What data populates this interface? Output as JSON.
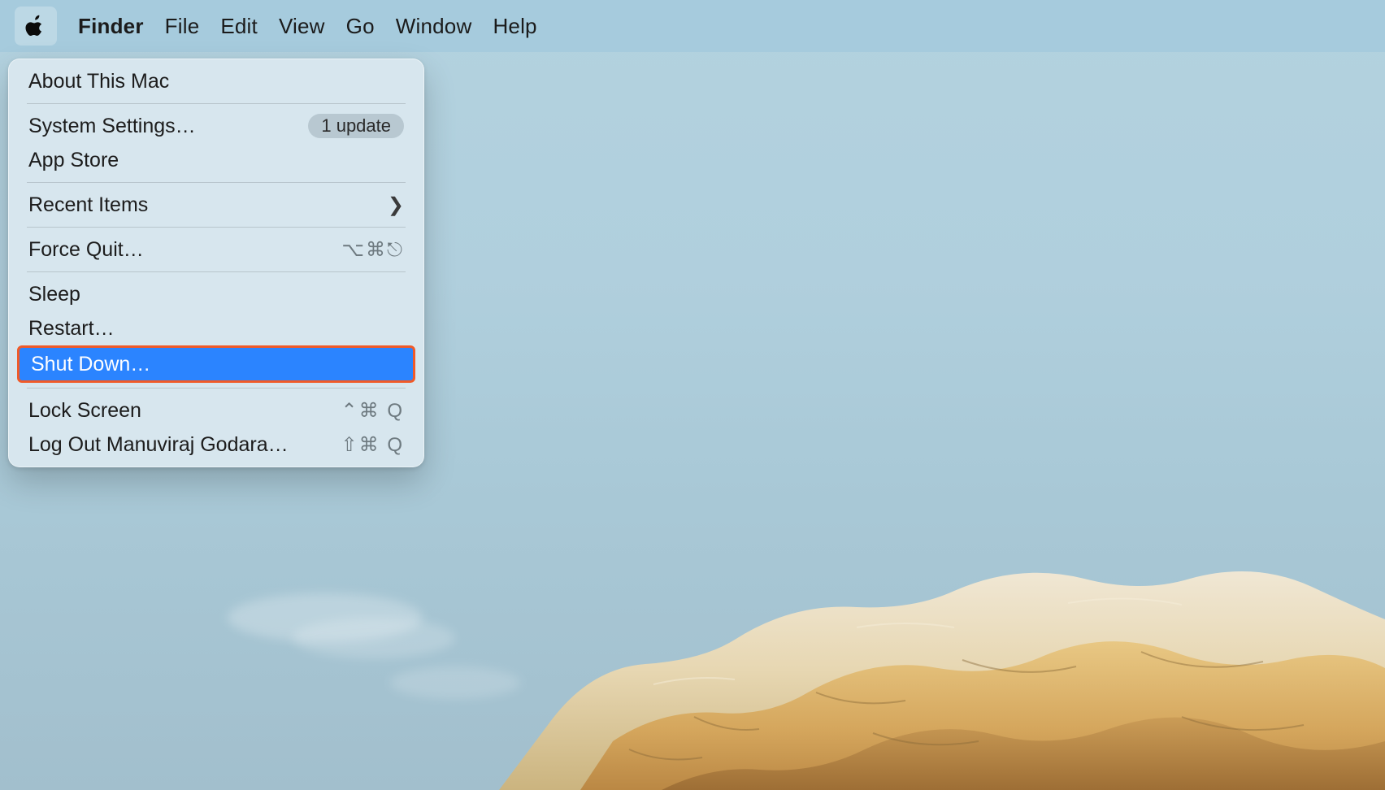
{
  "menubar": {
    "app": "Finder",
    "items": [
      "File",
      "Edit",
      "View",
      "Go",
      "Window",
      "Help"
    ]
  },
  "menu": {
    "about": "About This Mac",
    "settings": "System Settings…",
    "settings_badge": "1 update",
    "appstore": "App Store",
    "recent": "Recent Items",
    "forcequit": "Force Quit…",
    "forcequit_shortcut": "⌥⌘⎋",
    "sleep": "Sleep",
    "restart": "Restart…",
    "shutdown": "Shut Down…",
    "lock": "Lock Screen",
    "lock_shortcut": "⌃⌘ Q",
    "logout": "Log Out Manuviraj Godara…",
    "logout_shortcut": "⇧⌘ Q"
  }
}
